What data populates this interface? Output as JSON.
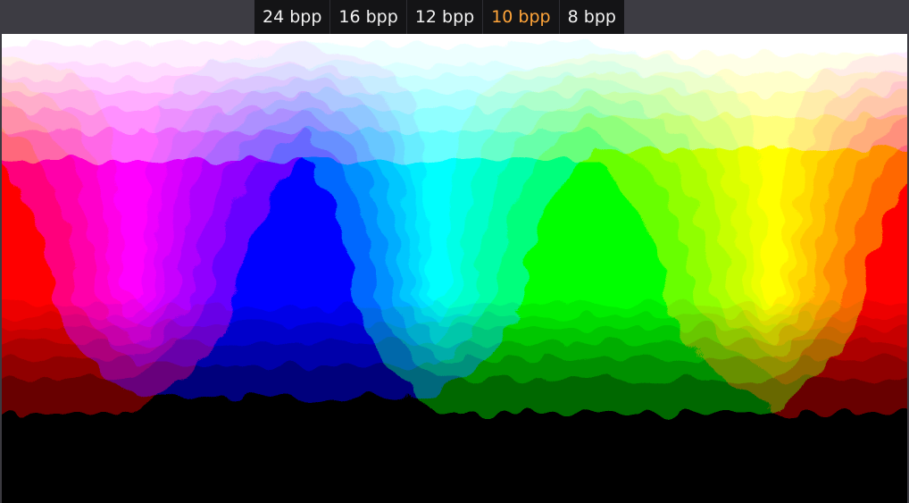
{
  "toolbar": {
    "tabs": [
      {
        "label": "24 bpp",
        "active": false
      },
      {
        "label": "16 bpp",
        "active": false
      },
      {
        "label": "12 bpp",
        "active": false
      },
      {
        "label": "10 bpp",
        "active": true
      },
      {
        "label": "8 bpp",
        "active": false
      }
    ],
    "active_color": "#ffa53a",
    "text_color": "#f2f2f2"
  },
  "canvas": {
    "content": "color-spectrum-voronoi",
    "hue_stops": [
      {
        "hue": "red",
        "color": "#ff0000"
      },
      {
        "hue": "magenta",
        "color": "#ff00ff"
      },
      {
        "hue": "blue",
        "color": "#0000ff"
      },
      {
        "hue": "cyan",
        "color": "#00ffff"
      },
      {
        "hue": "green",
        "color": "#00ff00"
      },
      {
        "hue": "yellow",
        "color": "#ffff00"
      },
      {
        "hue": "red",
        "color": "#ff0000"
      }
    ]
  }
}
